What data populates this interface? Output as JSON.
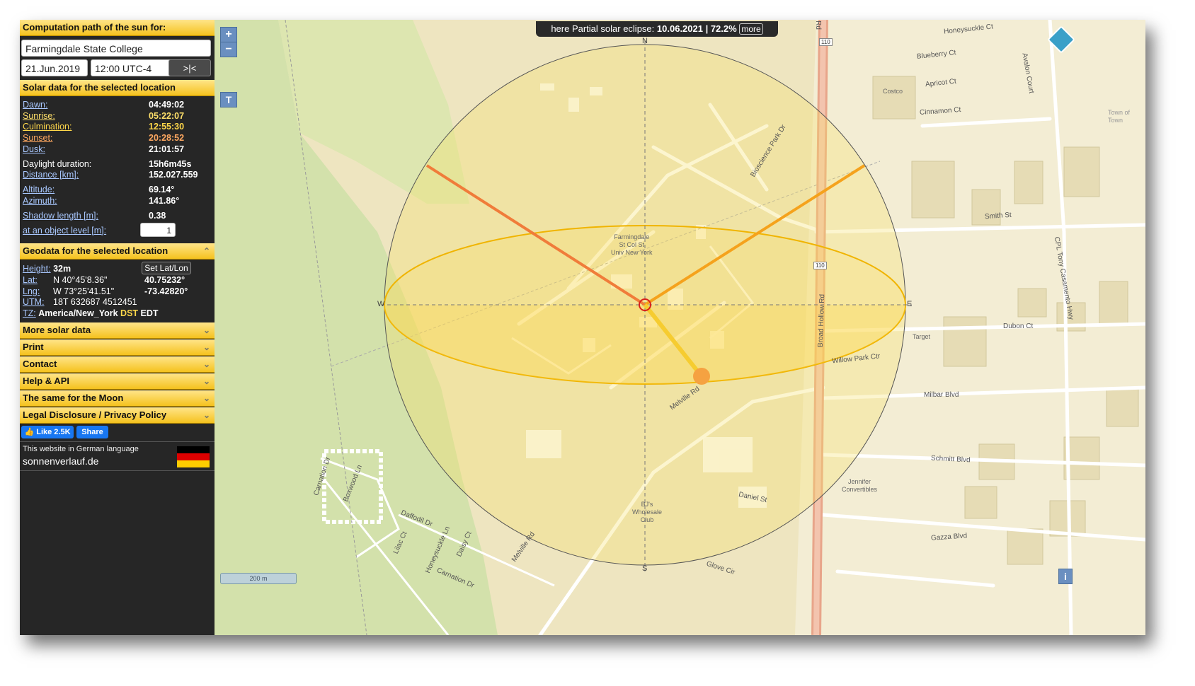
{
  "sidebar": {
    "header_path": "Computation path of the sun for:",
    "location_value": "Farmingdale State College",
    "date_value": "21.Jun.2019",
    "time_value": "12:00 UTC-4",
    "now_button": ">|<",
    "header_solar": "Solar data for the selected location",
    "solar": {
      "dawn_label": "Dawn:",
      "dawn": "04:49:02",
      "sunrise_label": "Sunrise:",
      "sunrise": "05:22:07",
      "culmination_label": "Culmination:",
      "culmination": "12:55:30",
      "sunset_label": "Sunset:",
      "sunset": "20:28:52",
      "dusk_label": "Dusk:",
      "dusk": "21:01:57",
      "daylight_label": "Daylight duration:",
      "daylight": "15h6m45s",
      "distance_label": "Distance [km]:",
      "distance": "152.027.559",
      "altitude_label": "Altitude:",
      "altitude": "69.14°",
      "azimuth_label": "Azimuth:",
      "azimuth": "141.86°",
      "shadow_label": "Shadow length [m]:",
      "shadow": "0.38",
      "object_label": "at an object level [m]:",
      "object_value": "1"
    },
    "header_geo": "Geodata for the selected location",
    "geo": {
      "height_label": "Height:",
      "height": "32m",
      "set_button": "Set Lat/Lon",
      "lat_label": "Lat:",
      "lat_dms": "N 40°45'8.36\"",
      "lat_dec": "40.75232°",
      "lng_label": "Lng:",
      "lng_dms": "W 73°25'41.51\"",
      "lng_dec": "-73.42820°",
      "utm_label": "UTM:",
      "utm": "18T 632687 4512451",
      "tz_label": "TZ:",
      "tz": "America/New_York",
      "dst": "DST",
      "edt": "EDT"
    },
    "sections": [
      "More solar data",
      "Print",
      "Contact",
      "Help & API",
      "The same for the Moon",
      "Legal Disclosure / Privacy Policy"
    ],
    "like_label": "Like 2.5K",
    "share_label": "Share",
    "german_text": "This website in German language",
    "german_site": "sonnenverlauf.de"
  },
  "map": {
    "eclipse_prefix": "here Partial solar eclipse:",
    "eclipse_value": "10.06.2021 | 72.2%",
    "more_label": "more",
    "zoom_in": "+",
    "zoom_out": "−",
    "t_label": "T",
    "info_label": "i",
    "scale_label": "200 m",
    "compass": {
      "n": "N",
      "s": "S",
      "e": "E",
      "w": "W"
    },
    "places": {
      "campus": [
        "Farmingdale",
        "St Col St",
        "Univ New York"
      ],
      "costco": "Costco",
      "target": "Target",
      "bjs": [
        "BJ's",
        "Wholesale",
        "Club"
      ],
      "jennifer": [
        "Jennifer",
        "Convertibles"
      ],
      "town": [
        "Town of",
        "Town"
      ]
    },
    "streets": {
      "honeysuckle_ct": "Honeysuckle Ct",
      "blueberry_ct": "Blueberry Ct",
      "apricot_ct": "Apricot Ct",
      "cinnamon_ct": "Cinnamon Ct",
      "avalon_court": "Avalon Court",
      "smith_st": "Smith St",
      "dubon_ct": "Dubon Ct",
      "willow_park": "Willow Park Ctr",
      "milbar": "Milbar Blvd",
      "schmitt": "Schmitt Blvd",
      "daniel": "Daniel St",
      "gazza": "Gazza Blvd",
      "glove": "Glove Cir",
      "broad_hollow": "Broad Hollow Rd",
      "melville_rd_1": "Melville Rd",
      "melville_rd_2": "Melville Rd",
      "bioscience": "Bioscience Park Dr",
      "cpl_tony": "CPL Tony Casamento Hwy",
      "carnation": "Carnation Dr",
      "carnation2": "Carnation Dr",
      "boxwood": "Boxwood Ln",
      "daffodil": "Daffodil Dr",
      "lilac": "Lilac Ct",
      "honeysuckle_ln": "Honeysuckle Ln",
      "daisy": "Daisy Ct",
      "route_110_a": "110",
      "route_110_b": "110",
      "rd_label": "Rd"
    }
  }
}
